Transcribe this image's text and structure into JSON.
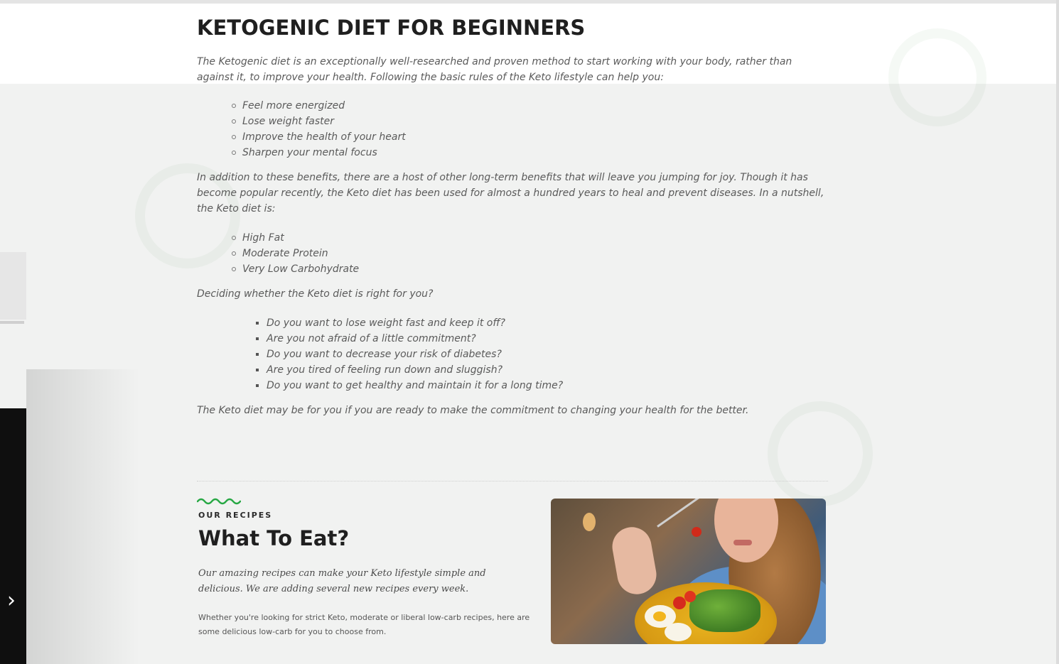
{
  "article": {
    "title": "KETOGENIC DIET FOR BEGINNERS",
    "intro": "The Ketogenic diet is an exceptionally well-researched and proven method to start working with your body, rather than against it, to improve your health.  Following the basic rules of the Keto lifestyle can help you:",
    "benefits": [
      "Feel more energized",
      "Lose weight faster",
      "Improve the health of your heart",
      "Sharpen your mental focus"
    ],
    "paragraph2": "In addition to these benefits, there are a host of other long-term benefits that will leave you jumping for joy. Though it has become popular recently, the Keto diet has been used for almost a hundred years to heal and prevent diseases. In a nutshell, the Keto diet is:",
    "macros": [
      "High Fat",
      "Moderate Protein",
      "Very Low Carbohydrate"
    ],
    "question_lead": "Deciding whether the Keto diet is right for you?",
    "questions": [
      "Do you want to lose weight fast and keep it off?",
      "Are you not afraid of a little commitment?",
      "Do you want to decrease your risk of diabetes?",
      "Are you tired of feeling run down and sluggish?",
      "Do you want to get healthy and maintain it for a long time?"
    ],
    "closing": "The Keto diet may be for you if you are ready to make the commitment to changing your health for the better."
  },
  "recipes": {
    "eyebrow": "OUR RECIPES",
    "title": "What To Eat?",
    "lead": "Our amazing recipes can make your Keto lifestyle simple and delicious. We are adding several new recipes every week.",
    "body": "Whether you're looking for strict Keto, moderate or liberal low-carb recipes, here are some delicious low-carb for you to choose from.",
    "accent_color": "#27a844"
  },
  "slider": {
    "next_icon": "chevron-right-icon",
    "next_glyph": "›"
  },
  "colors": {
    "background": "#f1f2f1",
    "heading": "#1f1f1f",
    "body_text": "#5a5a5a"
  }
}
